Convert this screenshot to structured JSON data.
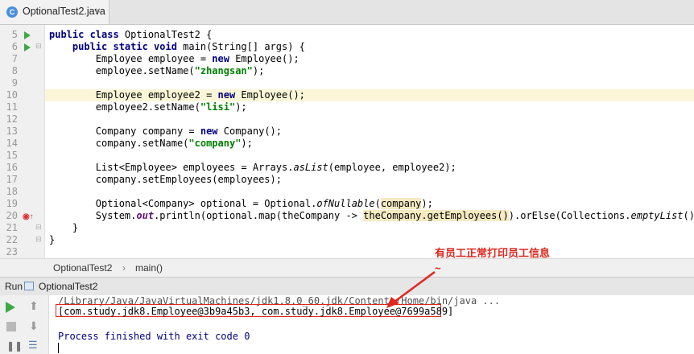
{
  "tab": {
    "title": "OptionalTest2.java",
    "close_glyph": "×"
  },
  "editor": {
    "line_numbers": [
      "5",
      "6",
      "7",
      "8",
      "9",
      "10",
      "11",
      "12",
      "13",
      "14",
      "15",
      "16",
      "17",
      "18",
      "19",
      "20",
      "21",
      "22",
      "23"
    ]
  },
  "breadcrumb": {
    "class_name": "OptionalTest2",
    "separator": "›",
    "method": "main()"
  },
  "run_panel": {
    "label": "Run",
    "config_name": "OptionalTest2"
  },
  "console": {
    "cmd_line": "/Library/Java/JavaVirtualMachines/jdk1.8.0_60.jdk/Contents/Home/bin/java ...",
    "output_line": "[com.study.jdk8.Employee@3b9a45b3, com.study.jdk8.Employee@7699a589]",
    "exit_line": "Process finished with exit code 0"
  },
  "annotation": {
    "text": "有员工正常打印员工信息~",
    "color": "#e0261d"
  },
  "colors": {
    "keyword": "#000080",
    "string": "#008000",
    "run_green": "#3da944",
    "highlight": "#f5eac0",
    "current_line": "#fbf6d8"
  }
}
